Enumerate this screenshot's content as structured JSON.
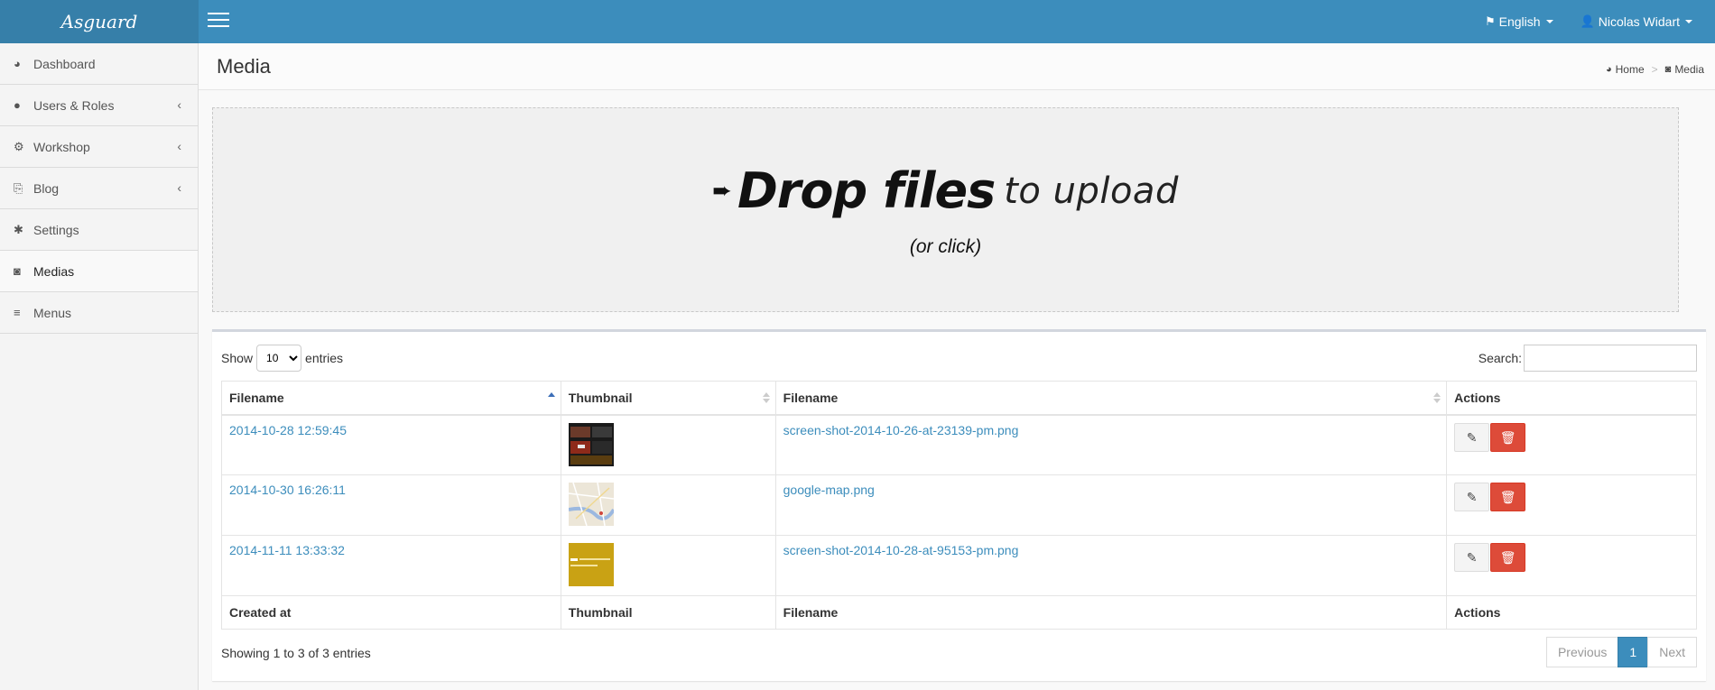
{
  "header": {
    "logo": "Asguard",
    "language": "English",
    "user": "Nicolas Widart"
  },
  "sidebar": {
    "items": [
      {
        "label": "Dashboard",
        "icon": "dashboard-icon",
        "has_children": false
      },
      {
        "label": "Users & Roles",
        "icon": "user-icon",
        "has_children": true
      },
      {
        "label": "Workshop",
        "icon": "cogs-icon",
        "has_children": true
      },
      {
        "label": "Blog",
        "icon": "copy-icon",
        "has_children": true
      },
      {
        "label": "Settings",
        "icon": "gear-icon",
        "has_children": false
      },
      {
        "label": "Medias",
        "icon": "camera-icon",
        "has_children": false,
        "active": true
      },
      {
        "label": "Menus",
        "icon": "bars-icon",
        "has_children": false
      }
    ]
  },
  "page": {
    "title": "Media",
    "breadcrumb": {
      "home": "Home",
      "current": "Media"
    }
  },
  "dropzone": {
    "bold": "Drop files",
    "light": "to upload",
    "sub": "(or click)"
  },
  "table": {
    "length_label_before": "Show",
    "length_value": "10",
    "length_label_after": "entries",
    "search_label": "Search:",
    "search_value": "",
    "headers": [
      "Filename",
      "Thumbnail",
      "Filename",
      "Actions"
    ],
    "footers": [
      "Created at",
      "Thumbnail",
      "Filename",
      "Actions"
    ],
    "rows": [
      {
        "created": "2014-10-28 12:59:45",
        "filename": "screen-shot-2014-10-26-at-23139-pm.png",
        "thumb": "dark"
      },
      {
        "created": "2014-10-30 16:26:11",
        "filename": "google-map.png",
        "thumb": "map"
      },
      {
        "created": "2014-11-11 13:33:32",
        "filename": "screen-shot-2014-10-28-at-95153-pm.png",
        "thumb": "gold"
      }
    ],
    "info": "Showing 1 to 3 of 3 entries",
    "pagination": {
      "previous": "Previous",
      "current": "1",
      "next": "Next"
    }
  },
  "colors": {
    "header": "#3c8dbc",
    "logo_bg": "#367fa9",
    "delete": "#dd4b39",
    "link": "#3c8dbc"
  }
}
